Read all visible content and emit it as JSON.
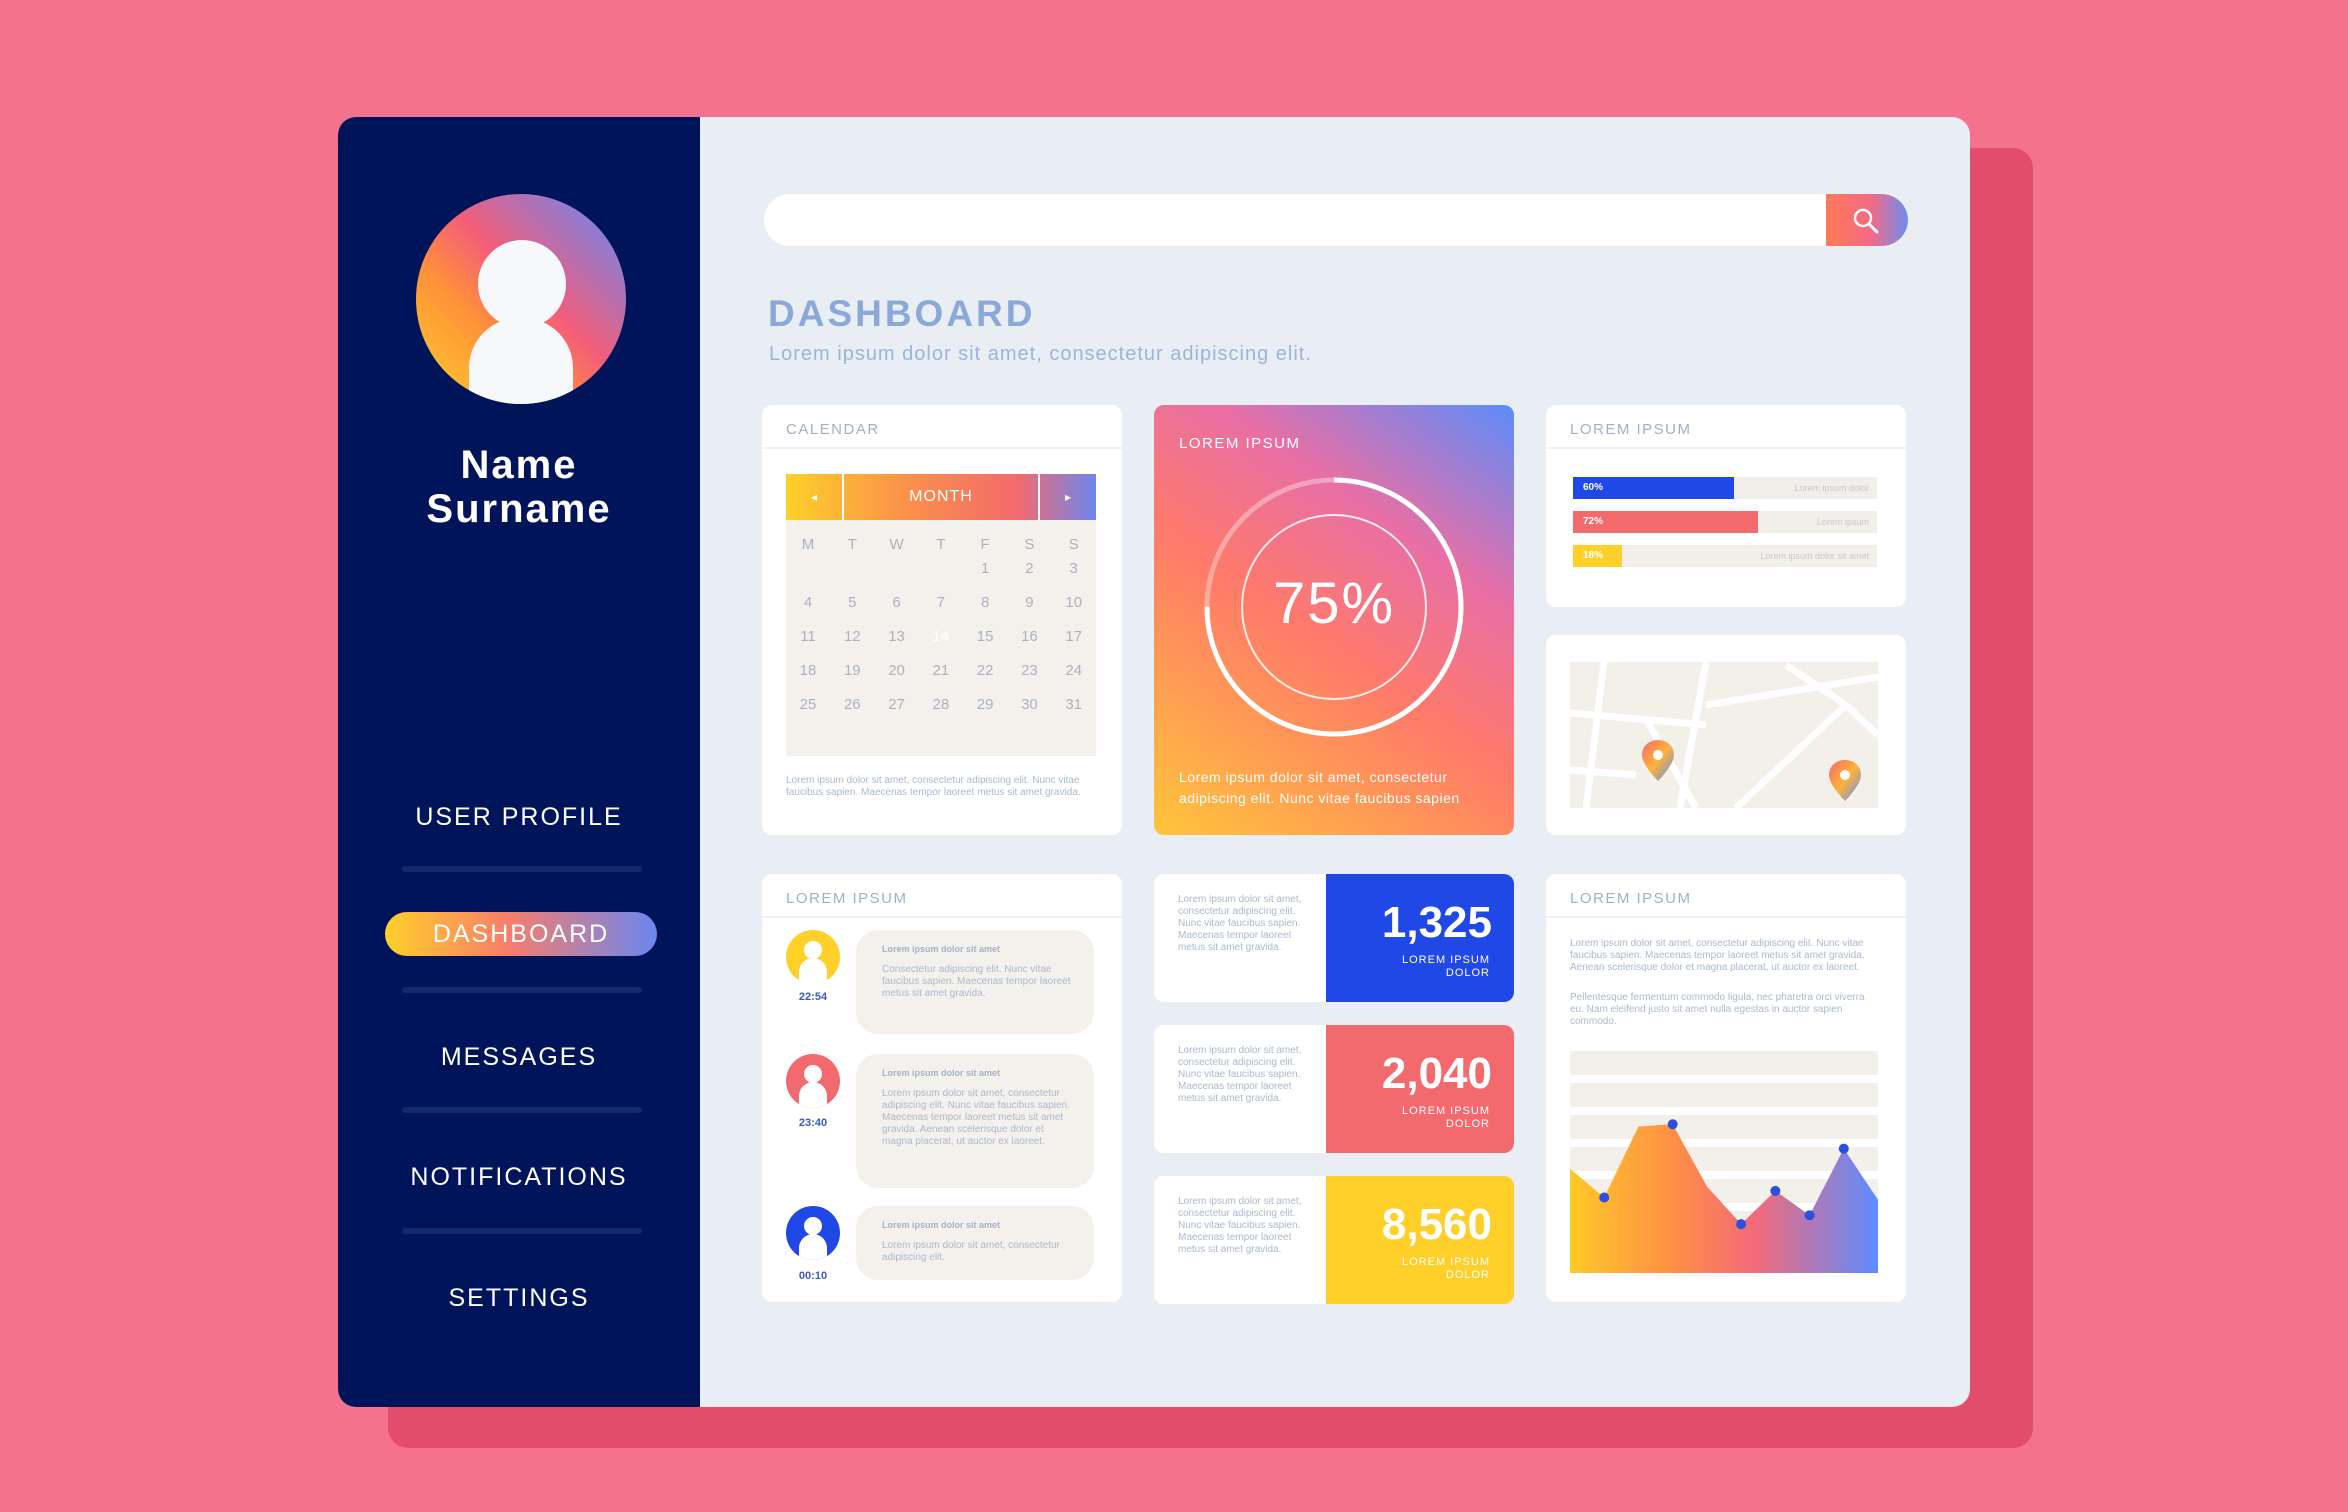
{
  "user": {
    "first_name": "Name",
    "last_name": "Surname"
  },
  "nav": [
    {
      "label": "USER PROFILE",
      "active": false
    },
    {
      "label": "DASHBOARD",
      "active": true
    },
    {
      "label": "MESSAGES",
      "active": false
    },
    {
      "label": "NOTIFICATIONS",
      "active": false
    },
    {
      "label": "SETTINGS",
      "active": false
    }
  ],
  "search": {
    "placeholder": ""
  },
  "header": {
    "title": "DASHBOARD",
    "subtitle": "Lorem ipsum dolor sit amet, consectetur adipiscing elit."
  },
  "calendar": {
    "title": "CALENDAR",
    "month": "MONTH",
    "prev": "◂",
    "next": "▸",
    "weekdays": [
      "M",
      "T",
      "W",
      "T",
      "F",
      "S",
      "S"
    ],
    "start_offset": 4,
    "days": 31,
    "today": 14,
    "note": "Lorem ipsum dolor sit amet, consectetur adipiscing elit. Nunc vitae faucibus sapien. Maecenas tempor laoreet metus sit amet gravida."
  },
  "progress_card": {
    "label": "LOREM IPSUM",
    "percent_text": "75%",
    "value": 0.75,
    "text": "Lorem ipsum dolor sit amet, consectetur adipiscing elit. Nunc vitae faucibus sapien"
  },
  "bars_card": {
    "title": "LOREM IPSUM",
    "bars": [
      {
        "label": "60%",
        "value": 0.53,
        "text": "Lorem ipsum dolor",
        "color": "#1f48e6"
      },
      {
        "label": "72%",
        "value": 0.61,
        "text": "Lorem ipsum",
        "color": "#f26a6e"
      },
      {
        "label": "18%",
        "value": 0.16,
        "text": "Lorem ipsum dolor sit amet",
        "color": "#ffcf2a"
      }
    ]
  },
  "map_card": {
    "pins": [
      "map-pin-icon",
      "map-pin-icon"
    ]
  },
  "chat_card": {
    "title": "LOREM IPSUM",
    "messages": [
      {
        "time": "22:54",
        "title": "Lorem ipsum dolor sit amet",
        "text": "Consectetur adipiscing elit. Nunc vitae faucibus sapien. Maecenas tempor laoreet metus sit amet gravida.",
        "color": "#ffcf2a"
      },
      {
        "time": "23:40",
        "title": "Lorem ipsum dolor sit amet",
        "text": "Lorem ipsum dolor sit amet, consectetur adipiscing elit. Nunc vitae faucibus sapien. Maecenas tempor laoreet metus sit amet gravida. Aenean scelerisque dolor et magna placerat, ut auctor ex laoreet.",
        "color": "#f26a6e"
      },
      {
        "time": "00:10",
        "title": "Lorem ipsum dolor sit amet",
        "text": "Lorem ipsum dolor sit amet, consectetur adipiscing elit.",
        "color": "#1f48e6"
      }
    ]
  },
  "stats": [
    {
      "value": "1,325",
      "label": "LOREM IPSUM DOLOR",
      "text": "Lorem ipsum dolor sit amet, consectetur adipiscing elit. Nunc vitae faucibus sapien. Maecenas tempor laoreet metus sit amet gravida.",
      "color": "#1f48e6"
    },
    {
      "value": "2,040",
      "label": "LOREM IPSUM DOLOR",
      "text": "Lorem ipsum dolor sit amet, consectetur adipiscing elit. Nunc vitae faucibus sapien. Maecenas tempor laoreet metus sit amet gravida.",
      "color": "#f26a6e"
    },
    {
      "value": "8,560",
      "label": "LOREM IPSUM DOLOR",
      "text": "Lorem ipsum dolor sit amet, consectetur adipiscing elit. Nunc vitae faucibus sapien. Maecenas tempor laoreet metus sit amet gravida.",
      "color": "#ffcf2a"
    }
  ],
  "chart_card": {
    "title": "LOREM IPSUM",
    "text1": "Lorem ipsum dolor sit amet, consectetur adipiscing elit. Nunc vitae faucibus sapien. Maecenas tempor laoreet metus sit amet gravida. Aenean scelerisque dolor et magna placerat, ut auctor ex laoreet.",
    "text2": "Pellentesque fermentum commodo ligula, nec pharetra orci viverra eu. Nam eleifend justo sit amet nulla egestas in auctor sapien commodo."
  },
  "chart_data": {
    "type": "area",
    "title": "",
    "xlabel": "",
    "ylabel": "",
    "ylim": [
      0,
      100
    ],
    "grid": true,
    "x": [
      0,
      1,
      2,
      3,
      4,
      5,
      6,
      7,
      8,
      9
    ],
    "series": [
      {
        "values": [
          47,
          34,
          66,
          67,
          39,
          22,
          37,
          26,
          56,
          33
        ]
      }
    ],
    "markers_at": [
      1,
      3,
      5,
      6,
      7,
      8
    ]
  },
  "colors": {
    "blue": "#1f48e6",
    "red": "#f26a6e",
    "yellow": "#ffcf2a",
    "navy": "#00145a"
  }
}
